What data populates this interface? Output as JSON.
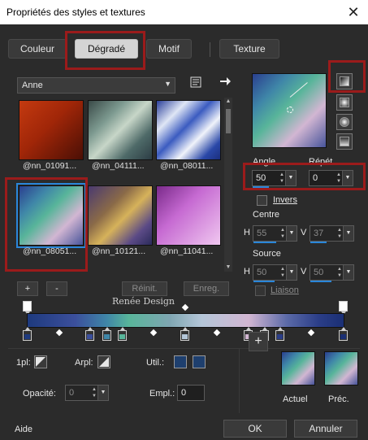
{
  "window": {
    "title": "Propriétés des styles et textures",
    "close_glyph": "✕"
  },
  "tabs": [
    {
      "label": "Couleur"
    },
    {
      "label": "Dégradé"
    },
    {
      "label": "Motif"
    },
    {
      "label": "Texture"
    }
  ],
  "preset": {
    "selected": "Anne"
  },
  "swatches": [
    {
      "label": "@nn_01091..."
    },
    {
      "label": "@nn_04111..."
    },
    {
      "label": "@nn_08011..."
    },
    {
      "label": "@nn_08051..."
    },
    {
      "label": "@nn_10121..."
    },
    {
      "label": "@nn_11041..."
    }
  ],
  "list_buttons": {
    "add": "+",
    "remove": "-",
    "reset": "Réinit.",
    "save": "Enreg."
  },
  "watermark": "Renée Design",
  "angle": {
    "label": "Angle",
    "value": "50"
  },
  "repeat": {
    "label": "Répét.",
    "value": "0"
  },
  "invert": {
    "label": "Invers"
  },
  "center": {
    "label": "Centre",
    "h_label": "H",
    "h_value": "55",
    "v_label": "V",
    "v_value": "37"
  },
  "source": {
    "label": "Source",
    "h_label": "H",
    "h_value": "50",
    "v_label": "V",
    "v_value": "50"
  },
  "link": {
    "label": "Liaison"
  },
  "stop_controls": {
    "loc_label": "1pl:",
    "arpl_label": "Arpl:",
    "util_label": "Util.:",
    "opacity_label": "Opacité:",
    "opacity_value": "0",
    "empl_label": "Empl.:",
    "empl_value": "0"
  },
  "compare": {
    "current_label": "Actuel",
    "previous_label": "Préc.",
    "add_glyph": "+"
  },
  "footer": {
    "help": "Aide",
    "ok": "OK",
    "cancel": "Annuler"
  },
  "icons": [
    "close-icon",
    "properties-icon",
    "arrow-right-icon",
    "linear-gradient-icon",
    "rectangular-gradient-icon",
    "sunburst-gradient-icon",
    "radial-gradient-icon"
  ],
  "colors": {
    "accent": "#2a86d9",
    "highlight_box": "#9b1b1b",
    "util_swatch": "#1e3f6e"
  }
}
